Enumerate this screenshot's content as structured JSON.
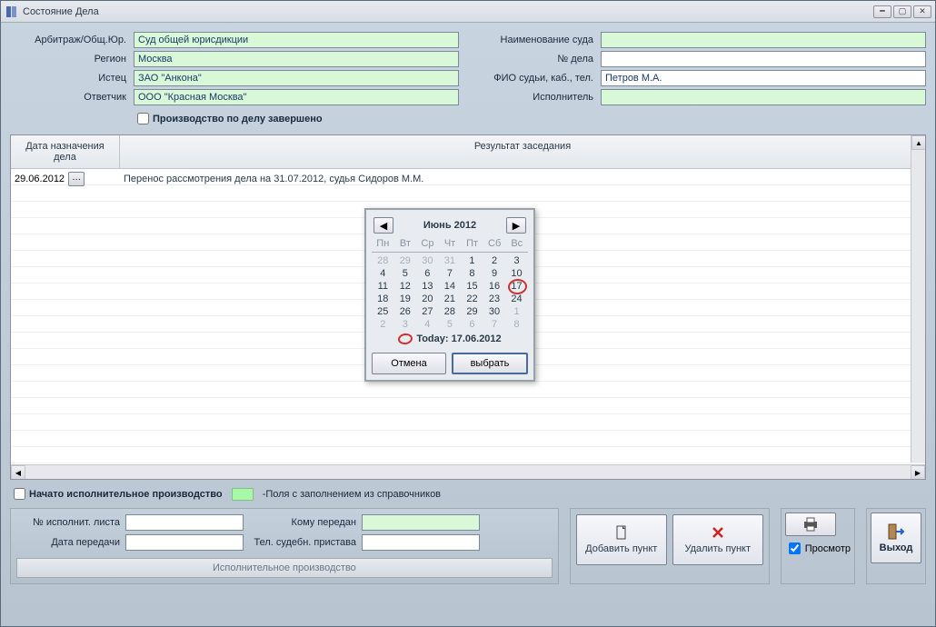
{
  "window": {
    "title": "Состояние Дела"
  },
  "labels": {
    "arbitrazh": "Арбитраж/Общ.Юр.",
    "region": "Регион",
    "istec": "Истец",
    "otvetchik": "Ответчик",
    "court_name": "Наименование суда",
    "case_no": "№ дела",
    "judge": "ФИО судьи, каб., тел.",
    "executor": "Исполнитель",
    "case_closed": "Производство по делу завершено",
    "col_date": "Дата назначения дела",
    "col_result": "Результат заседания",
    "exec_started": "Начато исполнительное производство",
    "legend": "-Поля с заполнением из справочников",
    "exec_no": "№ исполнит. листа",
    "exec_to": "Кому передан",
    "exec_date": "Дата передачи",
    "bailiff_tel": "Тел. судебн. пристава",
    "exec_title": "Исполнительное производство",
    "add": "Добавить пункт",
    "delete": "Удалить пункт",
    "preview": "Просмотр",
    "exit": "Выход"
  },
  "values": {
    "arbitrazh": "Суд общей юрисдикции",
    "region": "Москва",
    "istec": "ЗАО \"Анкона\"",
    "otvetchik": "ООО \"Красная Москва\"",
    "court_name": "",
    "case_no": "",
    "judge": "Петров М.А.",
    "executor": ""
  },
  "grid": {
    "rows": [
      {
        "date": "29.06.2012",
        "result": "Перенос рассмотрения дела на 31.07.2012, судья Сидоров М.М."
      }
    ]
  },
  "calendar": {
    "title": "Июнь 2012",
    "dow": [
      "Пн",
      "Вт",
      "Ср",
      "Чт",
      "Пт",
      "Сб",
      "Вс"
    ],
    "today_label": "Today: 17.06.2012",
    "cancel": "Отмена",
    "select": "выбрать",
    "weeks": [
      [
        {
          "d": "28",
          "o": true
        },
        {
          "d": "29",
          "o": true
        },
        {
          "d": "30",
          "o": true
        },
        {
          "d": "31",
          "o": true
        },
        {
          "d": "1"
        },
        {
          "d": "2"
        },
        {
          "d": "3"
        }
      ],
      [
        {
          "d": "4"
        },
        {
          "d": "5"
        },
        {
          "d": "6"
        },
        {
          "d": "7"
        },
        {
          "d": "8"
        },
        {
          "d": "9"
        },
        {
          "d": "10"
        }
      ],
      [
        {
          "d": "11"
        },
        {
          "d": "12"
        },
        {
          "d": "13"
        },
        {
          "d": "14"
        },
        {
          "d": "15"
        },
        {
          "d": "16"
        },
        {
          "d": "17",
          "t": true
        }
      ],
      [
        {
          "d": "18"
        },
        {
          "d": "19"
        },
        {
          "d": "20"
        },
        {
          "d": "21"
        },
        {
          "d": "22"
        },
        {
          "d": "23"
        },
        {
          "d": "24"
        }
      ],
      [
        {
          "d": "25"
        },
        {
          "d": "26"
        },
        {
          "d": "27"
        },
        {
          "d": "28"
        },
        {
          "d": "29"
        },
        {
          "d": "30"
        },
        {
          "d": "1",
          "o": true
        }
      ],
      [
        {
          "d": "2",
          "o": true
        },
        {
          "d": "3",
          "o": true
        },
        {
          "d": "4",
          "o": true
        },
        {
          "d": "5",
          "o": true
        },
        {
          "d": "6",
          "o": true
        },
        {
          "d": "7",
          "o": true
        },
        {
          "d": "8",
          "o": true
        }
      ]
    ]
  }
}
